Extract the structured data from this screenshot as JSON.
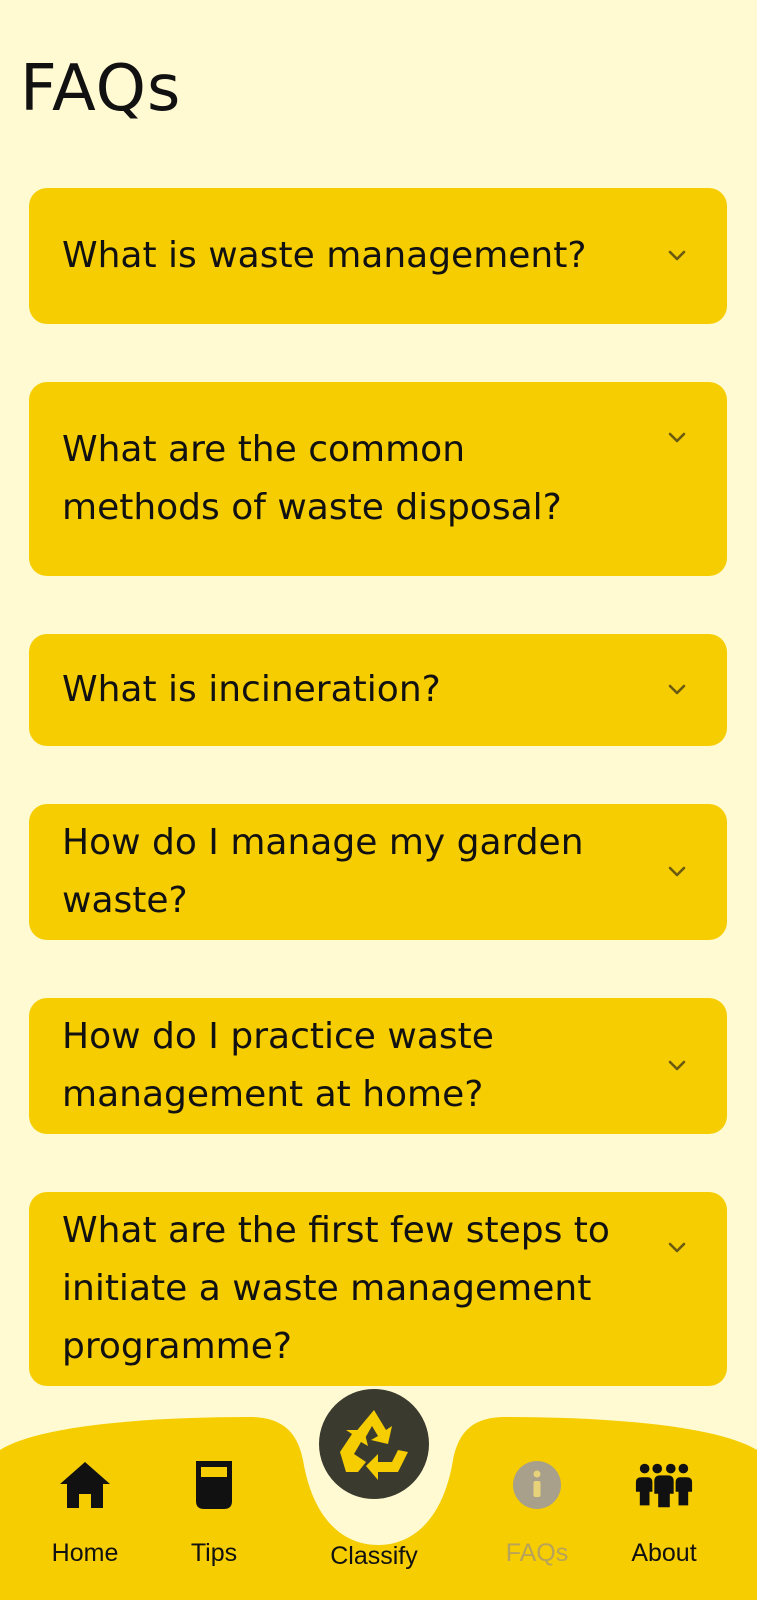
{
  "page": {
    "title": "FAQs"
  },
  "faqs": [
    {
      "question": "What is waste management?"
    },
    {
      "question": "What are the common methods of waste disposal?"
    },
    {
      "question": "What is incineration?"
    },
    {
      "question": "How do I manage my garden waste?"
    },
    {
      "question": "How do I practice waste management at home?"
    },
    {
      "question": "What are the first few steps to initiate a waste management programme?"
    }
  ],
  "bottom_nav": {
    "home": {
      "label": "Home",
      "icon": "home-icon"
    },
    "tips": {
      "label": "Tips",
      "icon": "cup-icon"
    },
    "classify": {
      "label": "Classify",
      "icon": "recycle-icon"
    },
    "faqs": {
      "label": "FAQs",
      "icon": "info-icon",
      "active": true
    },
    "about": {
      "label": "About",
      "icon": "people-icon"
    }
  },
  "colors": {
    "background": "#fffad2",
    "card": "#f6cd00",
    "nav_bar": "#f6cd00",
    "classify_button": "#3a3a2e",
    "active_label": "#b8a35a"
  }
}
